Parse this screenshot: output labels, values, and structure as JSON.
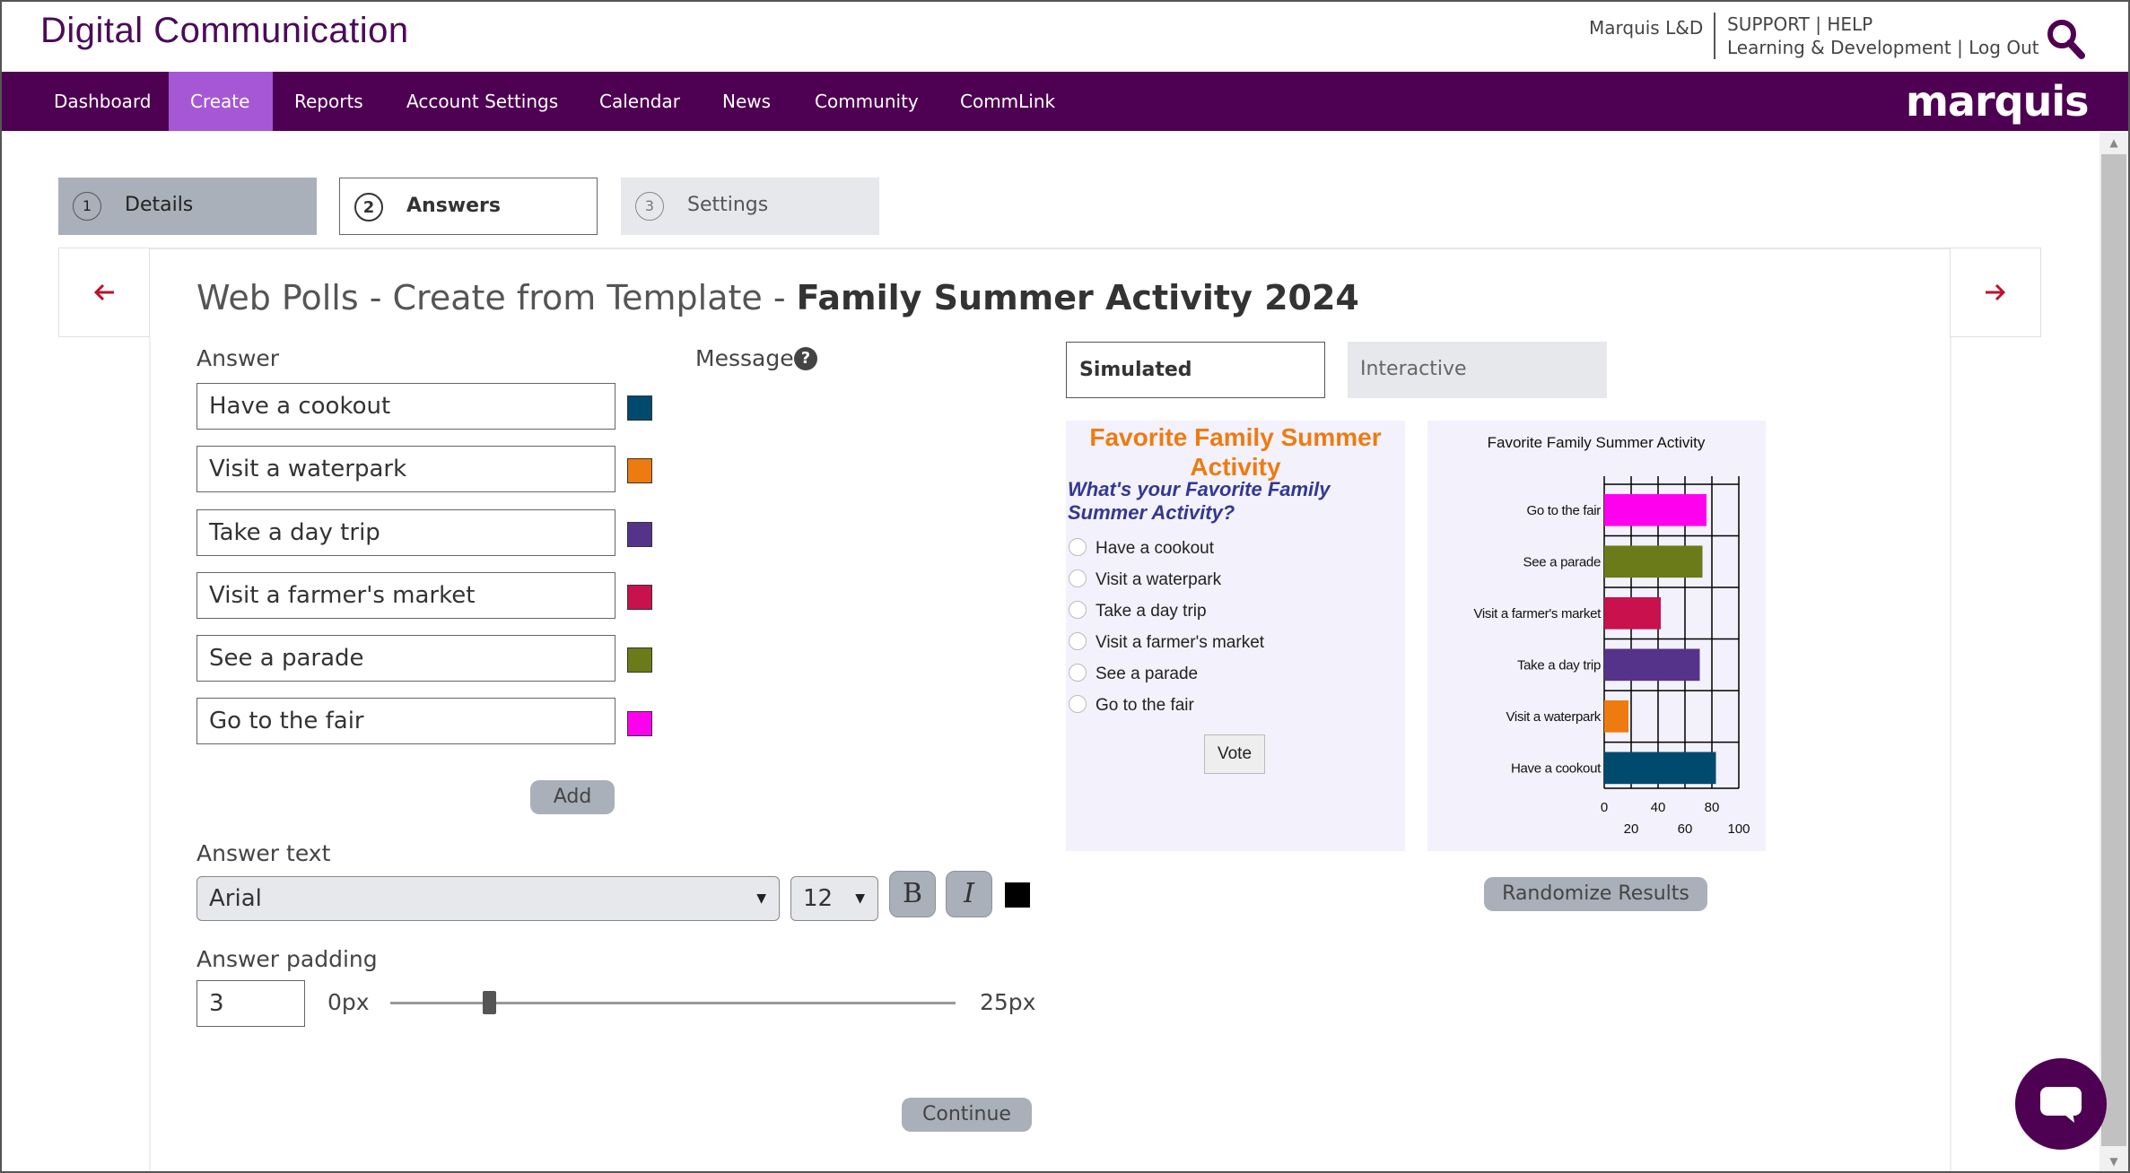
{
  "header": {
    "brand": "Digital Communication",
    "org": "Marquis L&D",
    "support": "SUPPORT",
    "help": "HELP",
    "learning": "Learning & Development",
    "logout": "Log Out",
    "sep1": "|",
    "sep2": "|"
  },
  "nav": {
    "items": [
      "Dashboard",
      "Create",
      "Reports",
      "Account Settings",
      "Calendar",
      "News",
      "Community",
      "CommLink"
    ],
    "active": "Create",
    "logo": "marquis"
  },
  "steps": [
    {
      "num": "1",
      "label": "Details"
    },
    {
      "num": "2",
      "label": "Answers"
    },
    {
      "num": "3",
      "label": "Settings"
    }
  ],
  "page": {
    "title_prefix": "Web Polls - Create from Template - ",
    "title_name": "Family Summer Activity 2024"
  },
  "answers_section": {
    "answer_label": "Answer",
    "message_label": "Message",
    "help_icon": "question-circle-icon",
    "answers": [
      {
        "text": "Have a cookout",
        "color": "#004a6e"
      },
      {
        "text": "Visit a waterpark",
        "color": "#ee7b10"
      },
      {
        "text": "Take a day trip",
        "color": "#55338a"
      },
      {
        "text": "Visit a farmer's market",
        "color": "#c8114d"
      },
      {
        "text": "See a parade",
        "color": "#6b7b1a"
      },
      {
        "text": "Go to the fair",
        "color": "#ff00ee"
      }
    ],
    "add_label": "Add"
  },
  "answer_text": {
    "label": "Answer text",
    "font": "Arial",
    "size": "12",
    "bold_label": "B",
    "italic_label": "I",
    "color": "#000000"
  },
  "answer_padding": {
    "label": "Answer padding",
    "value": "3",
    "min_label": "0px",
    "max_label": "25px",
    "min": 0,
    "max": 25
  },
  "continue_label": "Continue",
  "preview": {
    "tabs": [
      "Simulated",
      "Interactive"
    ],
    "active_tab": "Simulated",
    "poll_title": "Favorite Family Summer Activity",
    "poll_question": "What's your Favorite Family Summer Activity?",
    "options": [
      "Have a cookout",
      "Visit a waterpark",
      "Take a day trip",
      "Visit a farmer's market",
      "See a parade",
      "Go to the fair"
    ],
    "vote_label": "Vote",
    "randomize_label": "Randomize Results"
  },
  "chart_data": {
    "type": "bar",
    "orientation": "horizontal",
    "title": "Favorite Family Summer Activity",
    "categories": [
      "Go to the fair",
      "See a parade",
      "Visit a farmer's market",
      "Take a day trip",
      "Visit a waterpark",
      "Have a cookout"
    ],
    "values": [
      76,
      73,
      42,
      71,
      18,
      83
    ],
    "colors": [
      "#ff00ee",
      "#6b7b1a",
      "#c8114d",
      "#55338a",
      "#ee7b10",
      "#004a6e"
    ],
    "xlim": [
      0,
      100
    ],
    "xticks_top": [
      "0",
      "40",
      "80"
    ],
    "xticks_bottom": [
      "20",
      "60",
      "100"
    ],
    "grid": true
  }
}
